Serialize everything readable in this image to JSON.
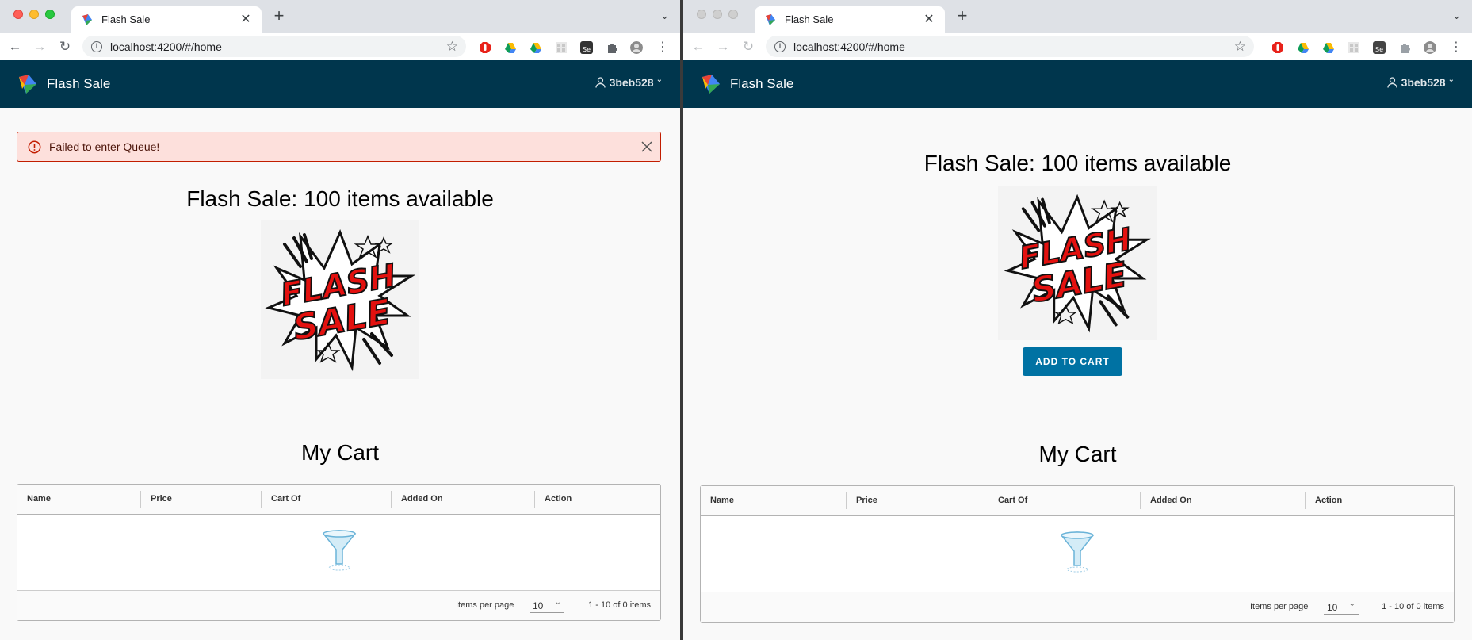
{
  "left_window": {
    "tab": {
      "title": "Flash Sale"
    },
    "toolbar": {
      "url": "localhost:4200/#/home"
    },
    "app": {
      "name": "Flash Sale",
      "user": "3beb528"
    },
    "alert": {
      "message": "Failed to enter Queue!"
    },
    "headline": "Flash Sale: 100 items available",
    "cart": {
      "title": "My Cart",
      "columns": [
        "Name",
        "Price",
        "Cart Of",
        "Added On",
        "Action"
      ],
      "rows": [],
      "items_per_page_label": "Items per page",
      "items_per_page_value": "10",
      "page_info": "1 - 10 of 0 items"
    }
  },
  "right_window": {
    "tab": {
      "title": "Flash Sale"
    },
    "toolbar": {
      "url": "localhost:4200/#/home"
    },
    "app": {
      "name": "Flash Sale",
      "user": "3beb528"
    },
    "headline": "Flash Sale: 100 items available",
    "add_to_cart_label": "ADD TO CART",
    "cart": {
      "title": "My Cart",
      "columns": [
        "Name",
        "Price",
        "Cart Of",
        "Added On",
        "Action"
      ],
      "rows": [],
      "items_per_page_label": "Items per page",
      "items_per_page_value": "10",
      "page_info": "1 - 10 of 0 items"
    }
  },
  "image_text": "FLASH SALE",
  "colors": {
    "header_bg": "#00364d",
    "primary_button": "#0072a3",
    "alert_bg": "#fde0dc",
    "alert_border": "#c21d00"
  },
  "icons": {
    "nav": [
      "back-icon",
      "forward-icon",
      "reload-icon"
    ],
    "extensions": [
      "adblock-icon",
      "google-drive-icon",
      "google-drive-icon",
      "grid-icon",
      "selenium-icon",
      "puzzle-icon",
      "profile-avatar-icon",
      "more-menu-icon"
    ]
  }
}
